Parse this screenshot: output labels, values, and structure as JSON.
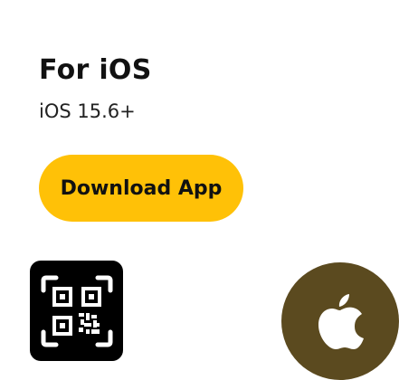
{
  "platform": {
    "title": "For iOS",
    "requirement": "iOS 15.6+"
  },
  "download": {
    "label": "Download App"
  },
  "qr": {
    "icon": "qr-code-icon"
  },
  "store": {
    "icon": "apple-logo-icon"
  },
  "colors": {
    "accent": "#FFC107",
    "apple_circle": "#5B4A1F",
    "apple_logo": "#FFFFFF",
    "qr_background": "#000000",
    "qr_foreground": "#FFFFFF"
  }
}
